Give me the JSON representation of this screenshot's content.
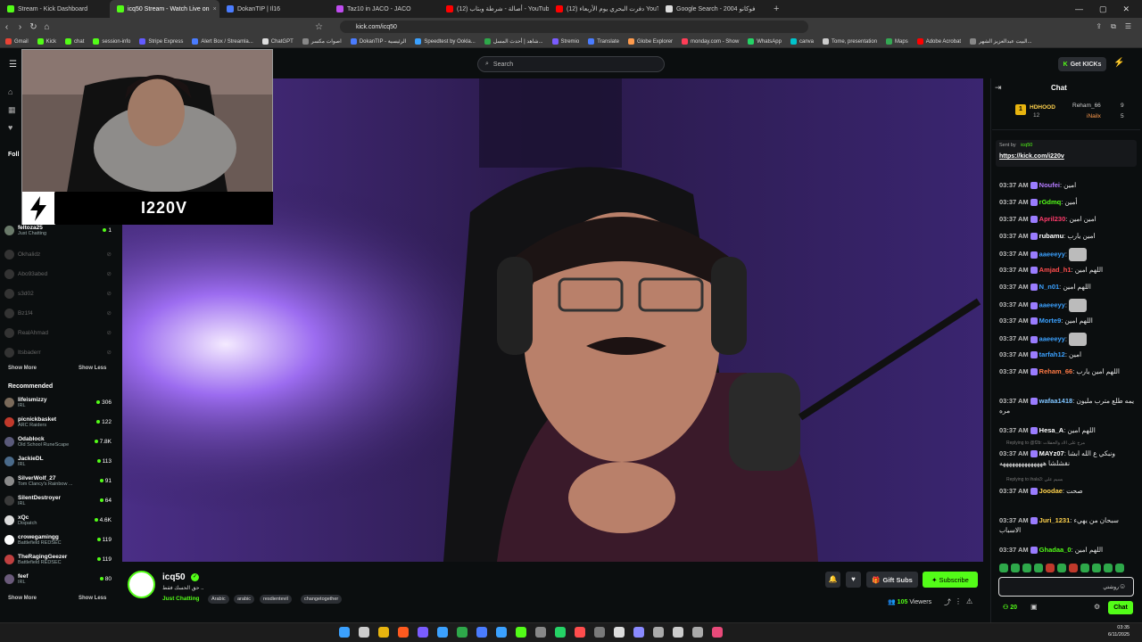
{
  "browser": {
    "tabs": [
      {
        "label": "Stream - Kick Dashboard",
        "color": "#53fc18"
      },
      {
        "label": "icq50 Stream - Watch Live on",
        "color": "#53fc18",
        "active": true
      },
      {
        "label": "DokanTIP | Il16",
        "color": "#4a7cff"
      },
      {
        "label": "Taz10 in JACO - JACO",
        "color": "#c04cf0"
      },
      {
        "label": "(12) أصالة - شرطة وبتاب - YouTube",
        "color": "#ff0000"
      },
      {
        "label": "(12) دفرت البحري يوم الأربعاء YouTube",
        "color": "#ff0000"
      },
      {
        "label": "Google Search - فوكانو 2004",
        "color": "#dddddd"
      }
    ],
    "new_tab": "+",
    "url": "kick.com/icq50",
    "bookmarks": [
      "Gmail",
      "Kick",
      "chat",
      "session-info",
      "Stripe Express",
      "Alert Box / Streamla...",
      "ChatGPT",
      "اصوات مكسر",
      "DokanTIP - الرئيسية",
      "Speedtest by Ookla...",
      "شاهد | أحدث المسل...",
      "Stremio",
      "Translate",
      "Globe Explorer",
      "monday.com - Show",
      "WhatsApp",
      "canva",
      "Tome, presentation",
      "Maps",
      "Adobe Acrobat",
      "البيت عبدالعزيز الشهر..."
    ]
  },
  "header": {
    "search_placeholder": "Search",
    "get_kicks": "Get KICKs"
  },
  "sidebar": {
    "following_label": "Foll",
    "following": [
      {
        "name": "feltoza25",
        "sub": "Just Chatting",
        "viewers": "1",
        "online": true
      },
      {
        "name": "Okhalidz",
        "online": false
      },
      {
        "name": "Abo93abed",
        "online": false
      },
      {
        "name": "s3d02",
        "online": false
      },
      {
        "name": "Bz1f4",
        "online": false
      },
      {
        "name": "RealAhmad",
        "online": false
      },
      {
        "name": "Itsbaderr",
        "online": false
      }
    ],
    "show_more": "Show More",
    "show_less": "Show Less",
    "recommended_title": "Recommended",
    "recommended": [
      {
        "name": "lifeismizzy",
        "sub": "IRL",
        "viewers": "306"
      },
      {
        "name": "picnickbasket",
        "sub": "ARC Raiders",
        "viewers": "122"
      },
      {
        "name": "Odablock",
        "sub": "Old School RuneScape",
        "viewers": "7.8K"
      },
      {
        "name": "JackieDL",
        "sub": "IRL",
        "viewers": "113"
      },
      {
        "name": "SilverWolf_27",
        "sub": "Tom Clancy's Rainbow ...",
        "viewers": "91"
      },
      {
        "name": "SilentDestroyer",
        "sub": "IRL",
        "viewers": "64"
      },
      {
        "name": "xQc",
        "sub": "Dispatch",
        "viewers": "4.6K"
      },
      {
        "name": "crowegamingg",
        "sub": "Battlefield REDSEC",
        "viewers": "119"
      },
      {
        "name": "TheRagingGeezer",
        "sub": "Battlefield REDSEC",
        "viewers": "119"
      },
      {
        "name": "feef",
        "sub": "IRL",
        "viewers": "80"
      }
    ]
  },
  "overlay": {
    "cam_name": "I220V"
  },
  "channel": {
    "name": "icq50",
    "title": "حق الحسك فقط ..",
    "category": "Just Chatting",
    "tags": [
      "Arabic",
      "arabic",
      "resdientevil",
      "changetogether"
    ],
    "gift_subs": "Gift Subs",
    "subscribe": "Subscribe",
    "viewers_count": "105",
    "viewers_label": "Viewers"
  },
  "chat": {
    "title": "Chat",
    "leaderboard": [
      {
        "name": "HDHOOD",
        "count": "12"
      },
      {
        "name": "Reham_66",
        "count": "9"
      },
      {
        "name": "iNailx",
        "count": "5"
      }
    ],
    "pinned": {
      "sent_by": "Sent by",
      "user": "icq50",
      "link": "https://kick.com/i220v"
    },
    "messages": [
      {
        "time": "03:37 AM",
        "user": "Noufei",
        "color": "#b57bff",
        "text": "امين"
      },
      {
        "time": "03:37 AM",
        "user": "rGdmq",
        "color": "#53fc18",
        "text": "أمين"
      },
      {
        "time": "03:37 AM",
        "user": "April230",
        "color": "#ff3b6b",
        "text": "امين امين"
      },
      {
        "time": "03:37 AM",
        "user": "rubamu",
        "color": "#ffffff",
        "text": "امين يارب"
      },
      {
        "time": "03:37 AM",
        "user": "aaeeeyy",
        "color": "#3ba1ff",
        "text": ""
      },
      {
        "time": "03:37 AM",
        "user": "Amjad_h1",
        "color": "#ff4d4d",
        "text": "اللهم امين"
      },
      {
        "time": "03:37 AM",
        "user": "N_n01",
        "color": "#3ba1ff",
        "text": "اللهم امين"
      },
      {
        "time": "03:37 AM",
        "user": "aaeeeyy",
        "color": "#3ba1ff",
        "text": ""
      },
      {
        "time": "03:37 AM",
        "user": "Morte9",
        "color": "#3ba1ff",
        "text": "اللهم امين"
      },
      {
        "time": "03:37 AM",
        "user": "aaeeeyy",
        "color": "#3ba1ff",
        "text": ""
      },
      {
        "time": "03:37 AM",
        "user": "tarfah12",
        "color": "#3ba1ff",
        "text": "امين"
      },
      {
        "time": "03:37 AM",
        "user": "Reham_66",
        "color": "#ff7a45",
        "text": "اللهم امين يارب"
      },
      {
        "time": "03:37 AM",
        "user": "wafaa1418",
        "color": "#7fc4ff",
        "text": "يمه طلع مترب مليون مره"
      },
      {
        "time": "03:37 AM",
        "user": "Hesa_A",
        "color": "#ffffff",
        "text": "اللهم امين"
      },
      {
        "time": "03:37 AM",
        "user": "MAYz07",
        "color": "#ffffff",
        "text": "ونبكي ع الله ابشا نقشلشا ههههههههههههههه"
      },
      {
        "time": "03:37 AM",
        "user": "Joodae",
        "color": "#ffd24d",
        "text": "صحت"
      },
      {
        "time": "03:37 AM",
        "user": "Juri_1231",
        "color": "#ffd24d",
        "text": "سبحان من يهيء الاسباب"
      },
      {
        "time": "03:37 AM",
        "user": "Ghadaa_0",
        "color": "#53fc18",
        "text": "اللهم امين"
      }
    ],
    "reply1": "Replying to @f2b: مرح على الاد والحفلات",
    "reply2": "Replying to ihala3: بسيم علي",
    "input_value": "روشتي",
    "kick_count": "20",
    "chat_button": "Chat"
  },
  "taskbar": {
    "time": "03:35",
    "date": "6/11/2025"
  },
  "colors": {
    "accent": "#53fc18",
    "bg": "#0b0e0f"
  }
}
